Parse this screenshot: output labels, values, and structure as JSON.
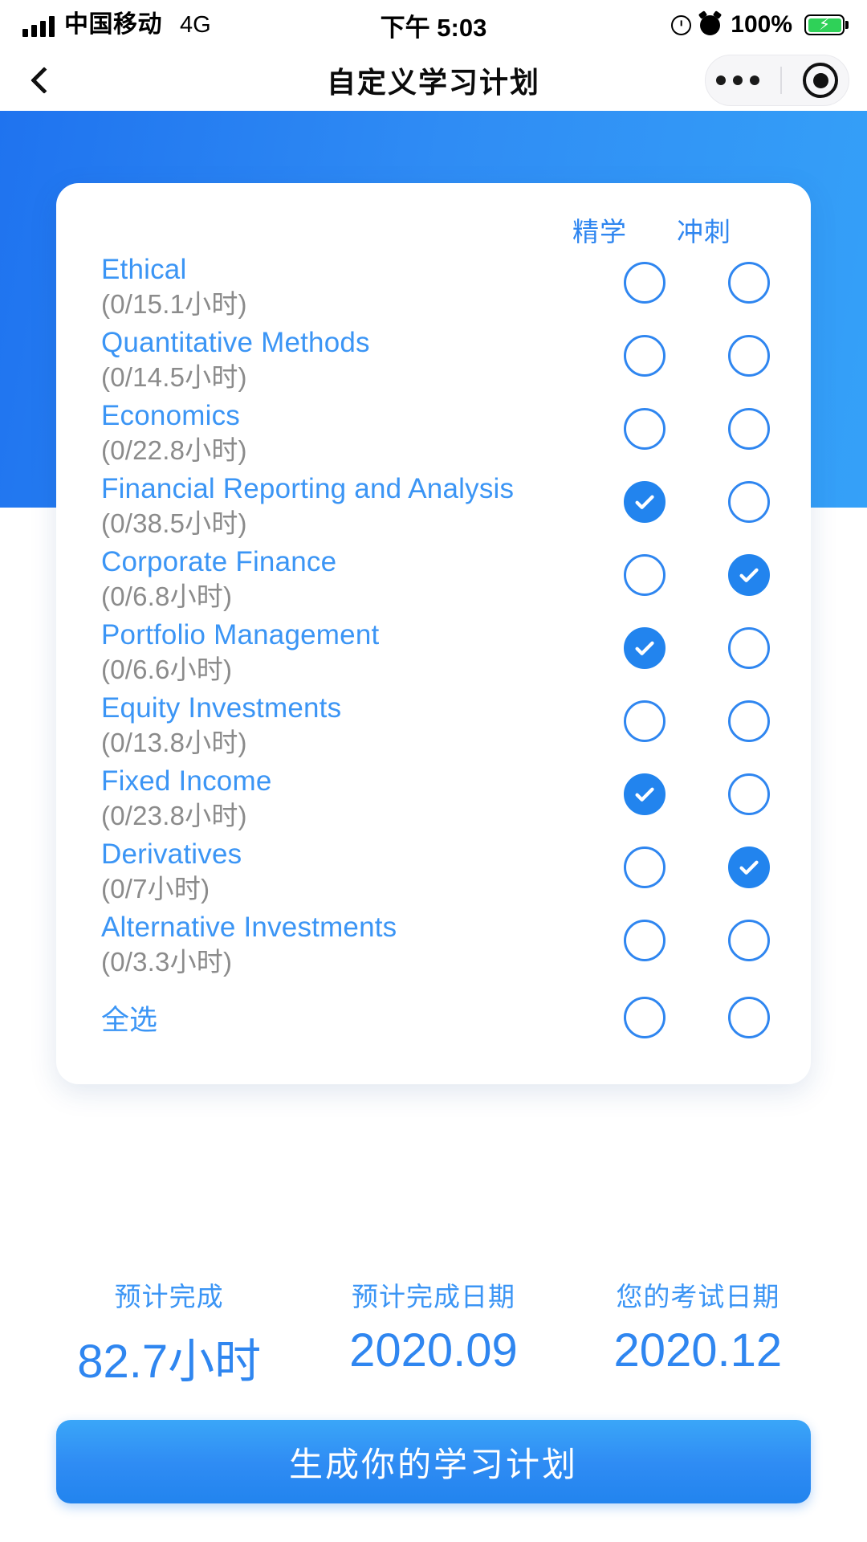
{
  "status_bar": {
    "carrier": "中国移动",
    "network": "4G",
    "time": "下午 5:03",
    "battery_percent": "100%",
    "lock_icon": "orientation-lock-icon",
    "alarm_icon": "alarm-icon",
    "battery_icon": "battery-charging-icon",
    "signal_icon": "signal-bars-icon"
  },
  "nav_bar": {
    "back_icon": "back-chevron-icon",
    "title": "自定义学习计划",
    "more_icon": "more-dots-icon",
    "capsule_icon": "target-circle-icon"
  },
  "card": {
    "columns": [
      {
        "label": "精学"
      },
      {
        "label": "冲刺"
      }
    ],
    "rows": [
      {
        "subject": "Ethical",
        "hours": "(0/15.1小时)",
        "jingxue": false,
        "chongci": false
      },
      {
        "subject": "Quantitative Methods",
        "hours": "(0/14.5小时)",
        "jingxue": false,
        "chongci": false
      },
      {
        "subject": "Economics",
        "hours": "(0/22.8小时)",
        "jingxue": false,
        "chongci": false
      },
      {
        "subject": "Financial Reporting and Analysis",
        "hours": "(0/38.5小时)",
        "jingxue": true,
        "chongci": false
      },
      {
        "subject": "Corporate Finance",
        "hours": "(0/6.8小时)",
        "jingxue": false,
        "chongci": true
      },
      {
        "subject": "Portfolio Management",
        "hours": "(0/6.6小时)",
        "jingxue": true,
        "chongci": false
      },
      {
        "subject": "Equity Investments",
        "hours": "(0/13.8小时)",
        "jingxue": false,
        "chongci": false
      },
      {
        "subject": "Fixed Income",
        "hours": "(0/23.8小时)",
        "jingxue": true,
        "chongci": false
      },
      {
        "subject": "Derivatives",
        "hours": "(0/7小时)",
        "jingxue": false,
        "chongci": true
      },
      {
        "subject": "Alternative Investments",
        "hours": "(0/3.3小时)",
        "jingxue": false,
        "chongci": false
      }
    ],
    "select_all": {
      "label": "全选",
      "jingxue": false,
      "chongci": false
    }
  },
  "summary": [
    {
      "label": "预计完成",
      "value": "82.7小时"
    },
    {
      "label": "预计完成日期",
      "value": "2020.09"
    },
    {
      "label": "您的考试日期",
      "value": "2020.12"
    }
  ],
  "cta": {
    "label": "生成你的学习计划"
  },
  "colors": {
    "accent": "#2f86f0",
    "link": "#3b95f5",
    "hero_start": "#1f73ef",
    "hero_end": "#35a1f8",
    "muted": "#8b8b8b",
    "battery_green": "#2fd158"
  }
}
